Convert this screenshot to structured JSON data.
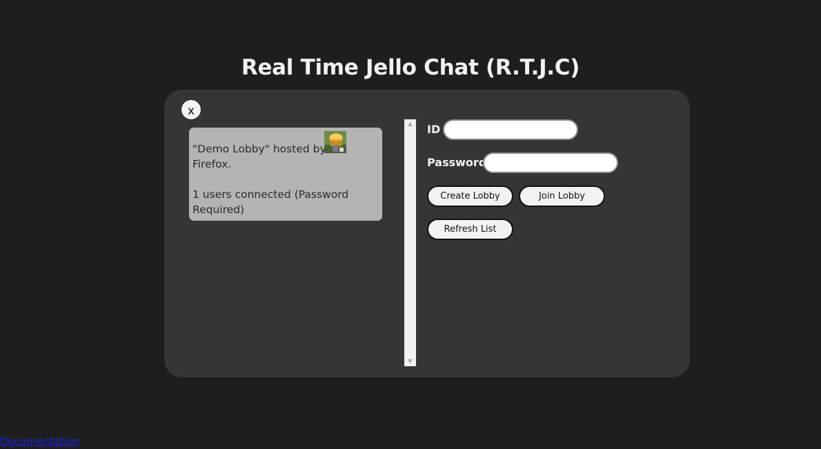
{
  "page": {
    "title": "Real Time Jello Chat (R.T.J.C)"
  },
  "panel": {
    "close_label": "x"
  },
  "lobbies": [
    {
      "line1": "\"Demo Lobby\" hosted by",
      "host_suffix": "Firefox.",
      "status": "1 users connected (Password Required)"
    }
  ],
  "form": {
    "id_label": "ID",
    "id_value": "",
    "password_label": "Password",
    "password_value": "",
    "create_label": "Create Lobby",
    "join_label": "Join Lobby",
    "refresh_label": "Refresh List"
  },
  "footer": {
    "documentation_label": "Documentation"
  },
  "colors": {
    "background": "#1e1e1e",
    "panel": "#353535",
    "lobby_card": "#b4b4b4",
    "link": "#2222ee"
  },
  "icons": {
    "close": "close-icon",
    "avatar": "host-avatar"
  }
}
